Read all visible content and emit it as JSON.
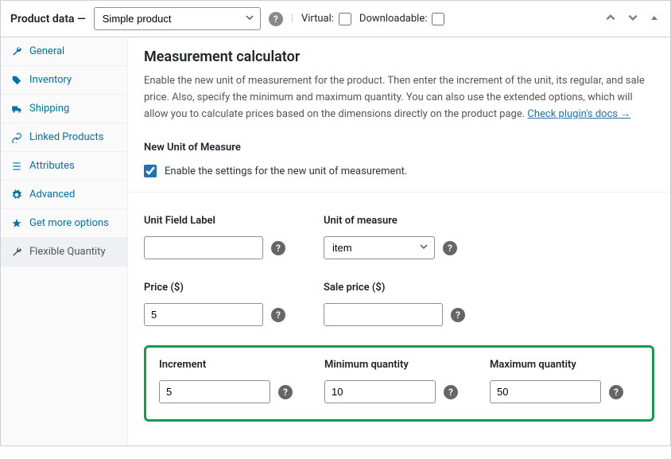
{
  "header": {
    "title": "Product data —",
    "product_type": "Simple product",
    "virtual_label": "Virtual:",
    "downloadable_label": "Downloadable:"
  },
  "tabs": [
    {
      "label": "General",
      "icon": "wrench"
    },
    {
      "label": "Inventory",
      "icon": "tag"
    },
    {
      "label": "Shipping",
      "icon": "truck"
    },
    {
      "label": "Linked Products",
      "icon": "link"
    },
    {
      "label": "Attributes",
      "icon": "list"
    },
    {
      "label": "Advanced",
      "icon": "gear"
    },
    {
      "label": "Get more options",
      "icon": "star"
    },
    {
      "label": "Flexible Quantity",
      "icon": "wrench"
    }
  ],
  "content": {
    "heading": "Measurement calculator",
    "description_a": "Enable the new unit of measurement for the product. Then enter the increment of the unit, its regular, and sale price. Also, specify the minimum and maximum quantity. You can also use the extended options, which will allow you to calculate prices based on the dimensions directly on the product page. ",
    "docs_link": "Check plugin's docs →",
    "section_title": "New Unit of Measure",
    "enable_label": "Enable the settings for the new unit of measurement.",
    "fields": {
      "unit_field_label": {
        "label": "Unit Field Label",
        "value": ""
      },
      "unit_of_measure": {
        "label": "Unit of measure",
        "value": "item"
      },
      "price": {
        "label": "Price ($)",
        "value": "5"
      },
      "sale_price": {
        "label": "Sale price ($)",
        "value": ""
      },
      "increment": {
        "label": "Increment",
        "value": "5"
      },
      "min_qty": {
        "label": "Minimum quantity",
        "value": "10"
      },
      "max_qty": {
        "label": "Maximum quantity",
        "value": "50"
      }
    }
  }
}
